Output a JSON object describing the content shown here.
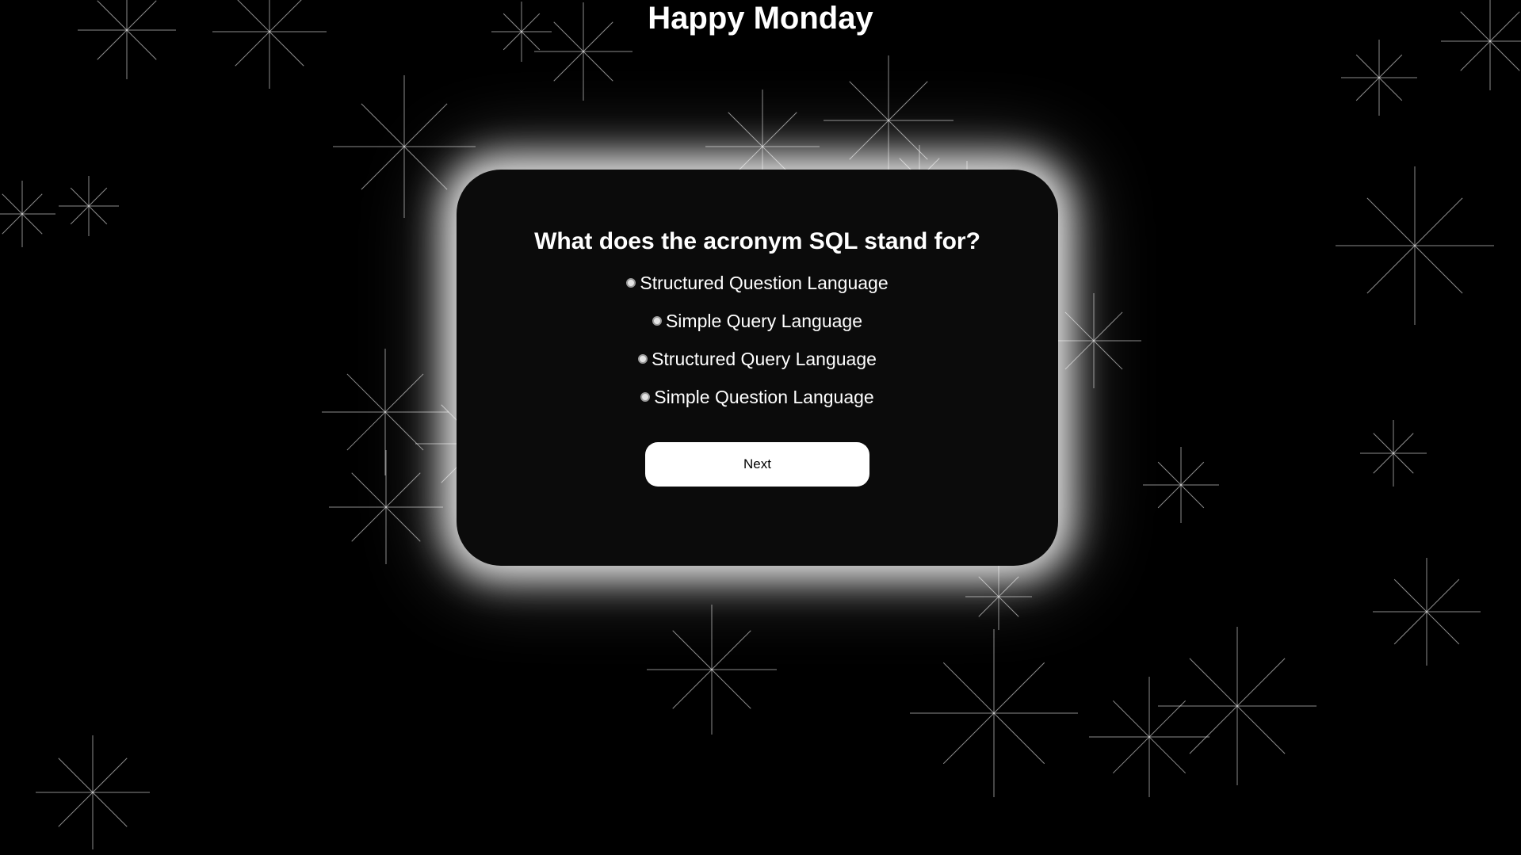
{
  "page": {
    "title": "Happy Monday",
    "background_color": "#000000",
    "card_color": "#0b0b0b",
    "glow_color": "#ffffff"
  },
  "quiz": {
    "question": "What does the acronym SQL stand for?",
    "options": [
      "Structured Question Language",
      "Simple Query Language",
      "Structured Query Language",
      "Simple Question Language"
    ],
    "next_label": "Next"
  }
}
